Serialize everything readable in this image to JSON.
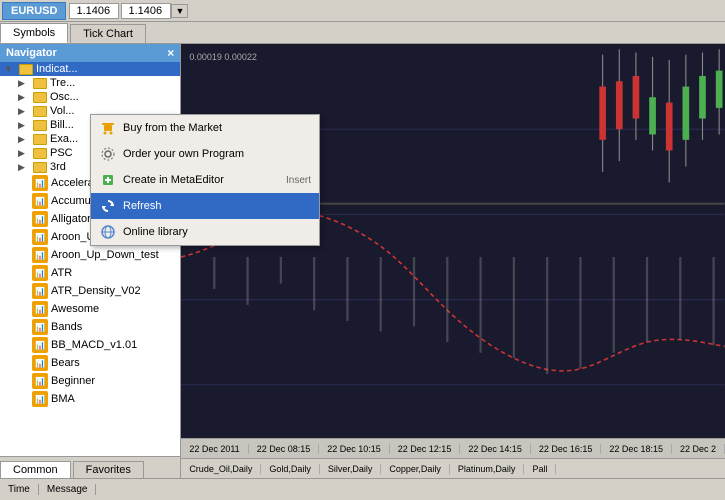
{
  "topbar": {
    "symbol": "EURUSD",
    "price1": "1.1406",
    "price2": "1.1406"
  },
  "tabs": {
    "symbols_label": "Symbols",
    "tick_chart_label": "Tick Chart"
  },
  "navigator": {
    "title": "Navigator",
    "close_label": "×",
    "sections": [
      {
        "label": "Indicators",
        "id": "indicators",
        "expanded": true
      },
      {
        "label": "Trend",
        "id": "trend"
      },
      {
        "label": "Oscillators",
        "id": "oscillators"
      },
      {
        "label": "Volumes",
        "id": "volumes"
      },
      {
        "label": "Bill Williams",
        "id": "bill_williams"
      },
      {
        "label": "Examples",
        "id": "examples"
      },
      {
        "label": "PSC",
        "id": "psc"
      },
      {
        "label": "3rd",
        "id": "3rd"
      }
    ],
    "indicators": [
      "Accelerator",
      "Accumulation",
      "Alligator",
      "Aroon_Up_Down",
      "Aroon_Up_Down_test",
      "ATR",
      "ATR_Density_V02",
      "Awesome",
      "Bands",
      "BB_MACD_v1.01",
      "Bears",
      "Beginner",
      "BMA"
    ]
  },
  "context_menu": {
    "items": [
      {
        "label": "Buy from the Market",
        "icon": "cart",
        "shortcut": ""
      },
      {
        "label": "Order your own Program",
        "icon": "gear",
        "shortcut": ""
      },
      {
        "label": "Create in MetaEditor",
        "icon": "plus-green",
        "shortcut": "Insert"
      },
      {
        "label": "Refresh",
        "icon": "refresh-blue",
        "shortcut": "",
        "highlighted": true
      },
      {
        "label": "Online library",
        "icon": "globe",
        "shortcut": ""
      }
    ]
  },
  "chart": {
    "price_high": "0.00022",
    "price_low": "0.00019",
    "value_label": "0.00019 0.00022"
  },
  "timeline": {
    "items": [
      "22 Dec 2011",
      "22 Dec 08:15",
      "22 Dec 10:15",
      "22 Dec 12:15",
      "22 Dec 14:15",
      "22 Dec 16:15",
      "22 Dec 18:15",
      "22 Dec 2"
    ]
  },
  "market_bar": {
    "items": [
      "Crude_Oil,Daily",
      "Gold,Daily",
      "Silver,Daily",
      "Copper,Daily",
      "Platinum,Daily",
      "Pall"
    ]
  },
  "bottom_tabs": {
    "common_label": "Common",
    "favorites_label": "Favorites"
  },
  "status_bar": {
    "time_label": "Time",
    "message_label": "Message"
  }
}
